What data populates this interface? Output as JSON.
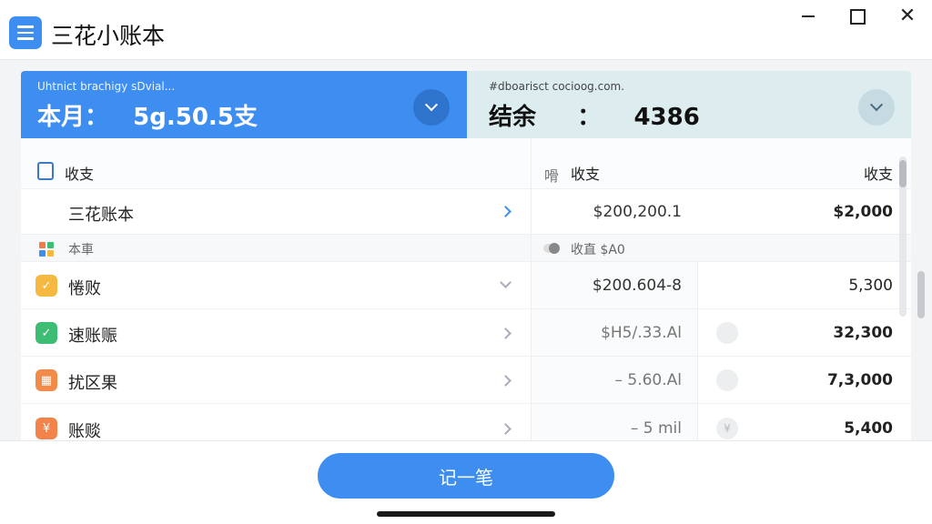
{
  "app": {
    "title": "三花小账本"
  },
  "window": {
    "close_glyph": "✕"
  },
  "summary": {
    "month": {
      "subtitle": "Uhtnict brachigy sDvial...",
      "text": "本月：   5g.50.5支"
    },
    "balance": {
      "subtitle": "#dboarisct cocioog.com.",
      "text": "结余     ：    4386"
    }
  },
  "table": {
    "headers": {
      "col1": "收支",
      "col2": "收支",
      "col3": "收支",
      "col2_icon": "嗗"
    },
    "rows": [
      {
        "icon_glyph": "〓",
        "icon_color": "#3d8ef0",
        "label": "三花账本",
        "mid": "$200,200.1",
        "right": "$2,000",
        "chev": "right-blue"
      },
      {
        "icon_glyph": "✓",
        "icon_color": "#f5b942",
        "label": "惓败",
        "mid": "$200.604-8",
        "right": "5,300",
        "chev": "down"
      },
      {
        "icon_glyph": "✓",
        "icon_color": "#3dbd73",
        "label": "速账赈",
        "mid": "$H5/.33.Al",
        "right": "32,300",
        "chev": "right"
      },
      {
        "icon_glyph": "▦",
        "icon_color": "#f28b4a",
        "label": "扰区果",
        "mid": "– 5.60.Al",
        "right": "7,3,000",
        "chev": "right"
      },
      {
        "icon_glyph": "¥",
        "icon_color": "#f2834a",
        "label": "账赕",
        "mid": "– 5 mil",
        "right": "5,400",
        "chev": "right",
        "dot_glyph": "¥"
      }
    ],
    "subrow": {
      "label": "本車",
      "right": "收直 $A0"
    }
  },
  "actions": {
    "add_label": "记一笔"
  },
  "colors": {
    "accent": "#3d8ef0",
    "balance_bg": "#dcecef"
  }
}
